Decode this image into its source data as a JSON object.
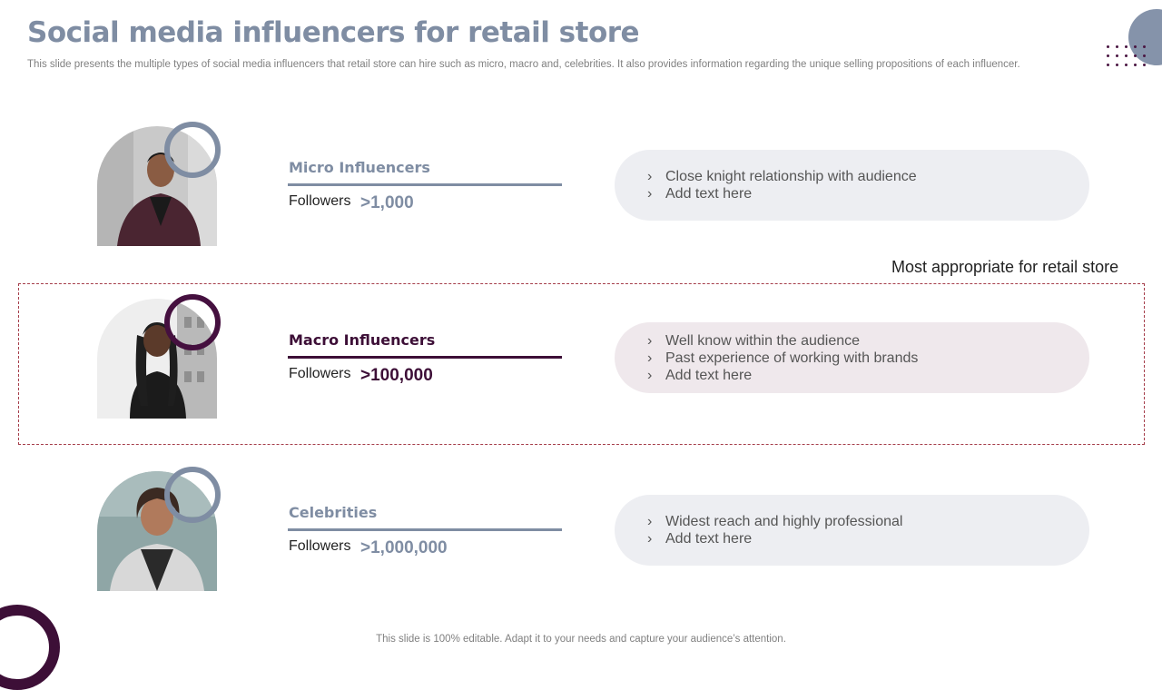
{
  "slide": {
    "title": "Social media influencers for retail store",
    "subtitle": "This slide presents the multiple types of social media influencers that retail store can hire such as micro, macro and, celebrities. It also provides information regarding the unique selling propositions of each influencer.",
    "footer": "This slide is 100% editable. Adapt it to your needs and capture your audience’s attention.",
    "highlight_label": "Most appropriate for retail store"
  },
  "influencers": [
    {
      "name": "Micro Influencers",
      "followers_label": "Followers",
      "followers_value": ">1,000",
      "points": [
        "Close knight relationship with audience",
        "Add text here"
      ]
    },
    {
      "name": "Macro Influencers",
      "followers_label": "Followers",
      "followers_value": ">100,000",
      "points": [
        "Well know within the audience",
        "Past experience of working with brands",
        "Add text here"
      ]
    },
    {
      "name": "Celebrities",
      "followers_label": "Followers",
      "followers_value": ">1,000,000",
      "points": [
        "Widest reach and highly professional",
        "Add text here"
      ]
    }
  ],
  "icons": {
    "bullet": "chevron-right-icon",
    "bullet_glyph": "›"
  },
  "colors": {
    "accent_gray": "#7f8da3",
    "accent_plum": "#3d0f37",
    "highlight_border": "#a53d4a"
  }
}
